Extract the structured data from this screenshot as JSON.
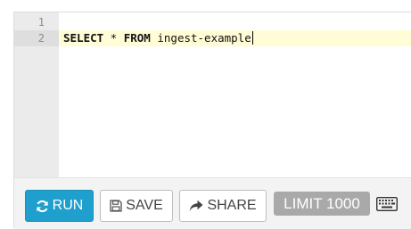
{
  "editor": {
    "lines": [
      {
        "number": "1",
        "keyword1": "",
        "middle": "",
        "keyword2": "",
        "rest": ""
      },
      {
        "number": "2",
        "keyword1": "SELECT",
        "middle": " * ",
        "keyword2": "FROM",
        "rest": " ingest-example"
      }
    ]
  },
  "toolbar": {
    "run_label": "RUN",
    "save_label": "SAVE",
    "share_label": "SHARE",
    "limit_label": "LIMIT 1000"
  },
  "colors": {
    "run_button": "#1f9fce",
    "active_line": "#fffcd6",
    "limit_badge": "#a9a9a9"
  },
  "icons": {
    "run": "refresh-icon",
    "save": "floppy-disk-icon",
    "share": "share-arrow-icon",
    "keyboard": "keyboard-icon"
  }
}
